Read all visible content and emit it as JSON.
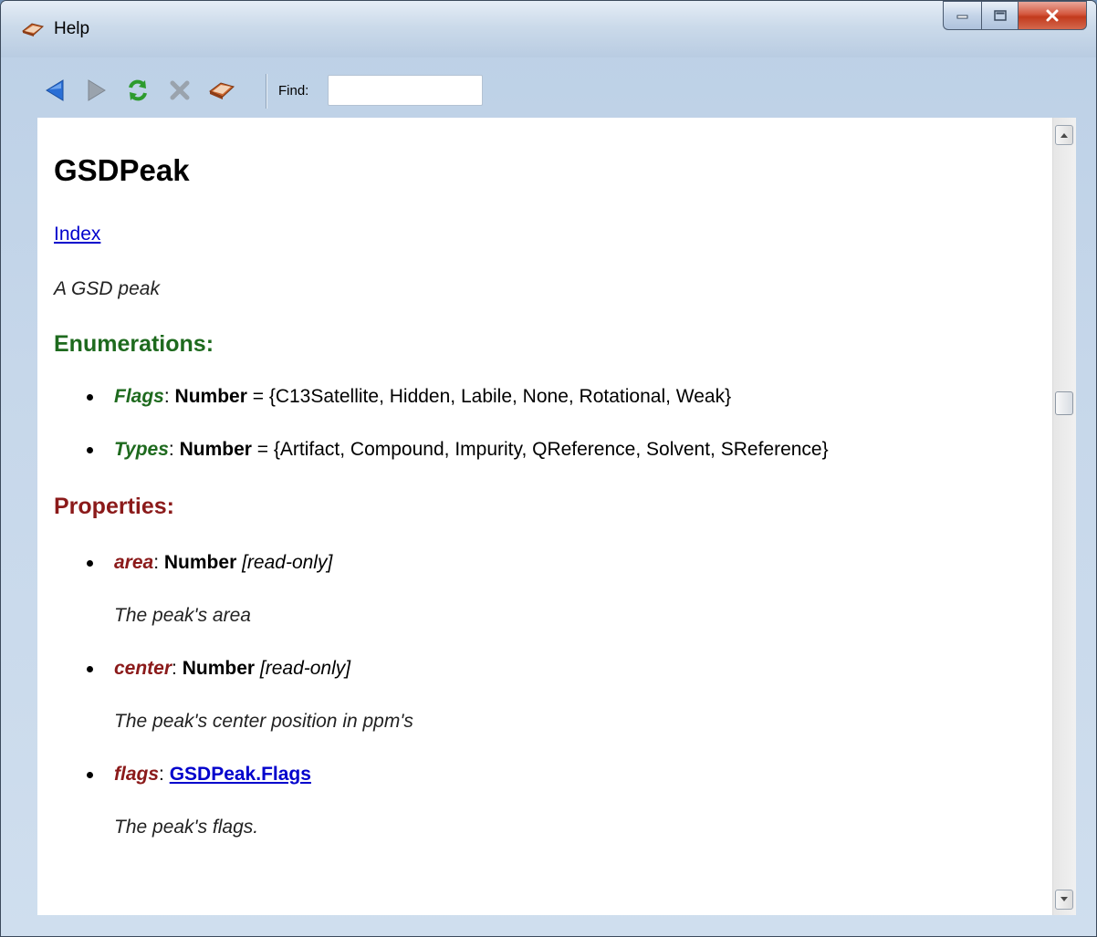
{
  "window": {
    "title": "Help",
    "icon": "book-icon"
  },
  "controls": {
    "minimize_icon": "minimize-icon",
    "maximize_icon": "maximize-icon",
    "close_icon": "close-icon"
  },
  "toolbar": {
    "icons": [
      "back-arrow-icon",
      "forward-arrow-icon",
      "refresh-icon",
      "stop-icon",
      "home-book-icon"
    ],
    "find_label": "Find:",
    "find_value": "",
    "find_placeholder": ""
  },
  "doc": {
    "title": "GSDPeak",
    "index_link": "Index",
    "description": "A GSD peak",
    "enumerations_heading": "Enumerations:",
    "enumerations": [
      {
        "name": "Flags",
        "sep": ": ",
        "type": "Number",
        "values": " = {C13Satellite, Hidden, Labile, None, Rotational, Weak}"
      },
      {
        "name": "Types",
        "sep": ": ",
        "type": "Number",
        "values": " = {Artifact, Compound, Impurity, QReference, Solvent, SReference}"
      }
    ],
    "properties_heading": "Properties:",
    "properties": [
      {
        "name": "area",
        "sep": ": ",
        "type": "Number",
        "qualifier": " [read-only]",
        "description": "The peak's area"
      },
      {
        "name": "center",
        "sep": ": ",
        "type": "Number",
        "qualifier": " [read-only]",
        "description": "The peak's center position in ppm's"
      },
      {
        "name": "flags",
        "sep": ": ",
        "type_link": "GSDPeak.Flags",
        "description": "The peak's flags."
      }
    ]
  },
  "scrollbar": {
    "up_icon": "scroll-up-arrow-icon",
    "down_icon": "scroll-down-arrow-icon"
  },
  "colors": {
    "enumerations": "#1e6a1e",
    "properties": "#8b1a1a",
    "link": "#0000cc"
  }
}
